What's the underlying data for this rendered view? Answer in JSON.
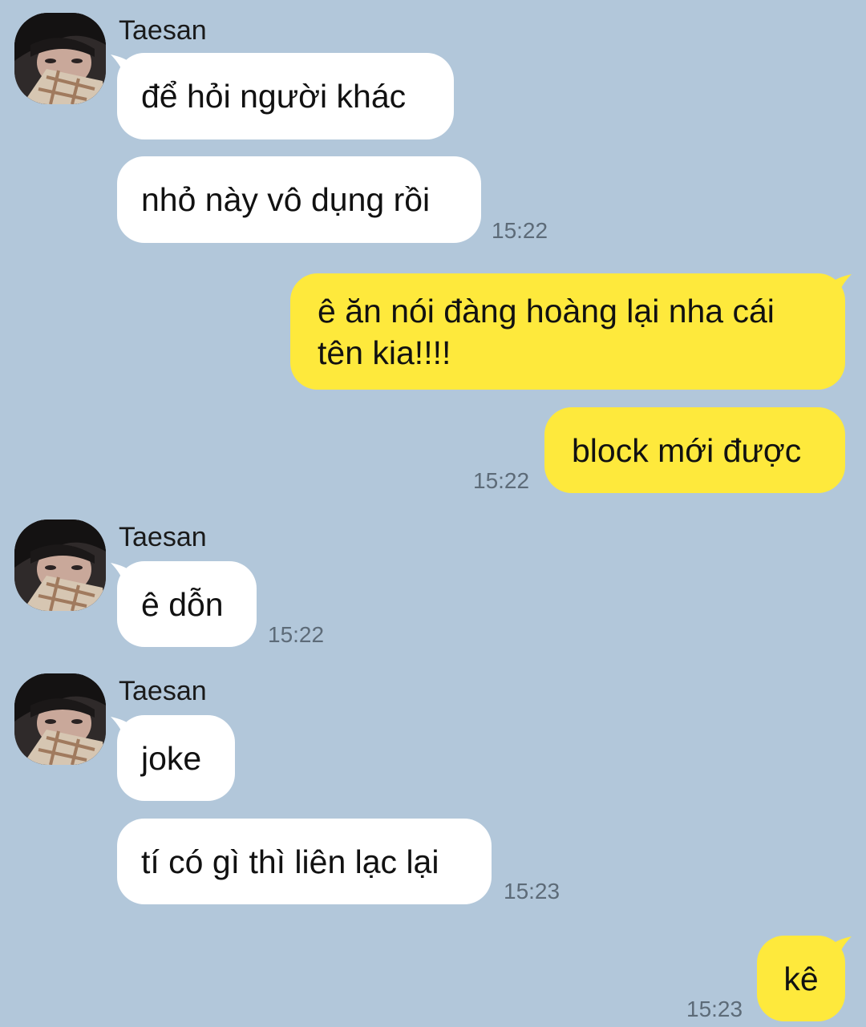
{
  "colors": {
    "background": "#b2c7da",
    "incoming_bubble": "#ffffff",
    "outgoing_bubble": "#fee93c"
  },
  "messages": [
    {
      "sender": "Taesan",
      "text": "để hỏi người khác"
    },
    {
      "text": "nhỏ này vô dụng rồi",
      "time": "15:22"
    },
    {
      "text": "ê ăn nói đàng hoàng lại nha cái tên kia!!!!"
    },
    {
      "text": "block mới được",
      "time": "15:22"
    },
    {
      "sender": "Taesan",
      "text": "ê dỗn",
      "time": "15:22"
    },
    {
      "sender": "Taesan",
      "text": "joke"
    },
    {
      "text": "tí có gì thì liên lạc lại",
      "time": "15:23"
    },
    {
      "text": "kê",
      "time": "15:23"
    }
  ],
  "avatar_icon": "profile-photo-icon"
}
